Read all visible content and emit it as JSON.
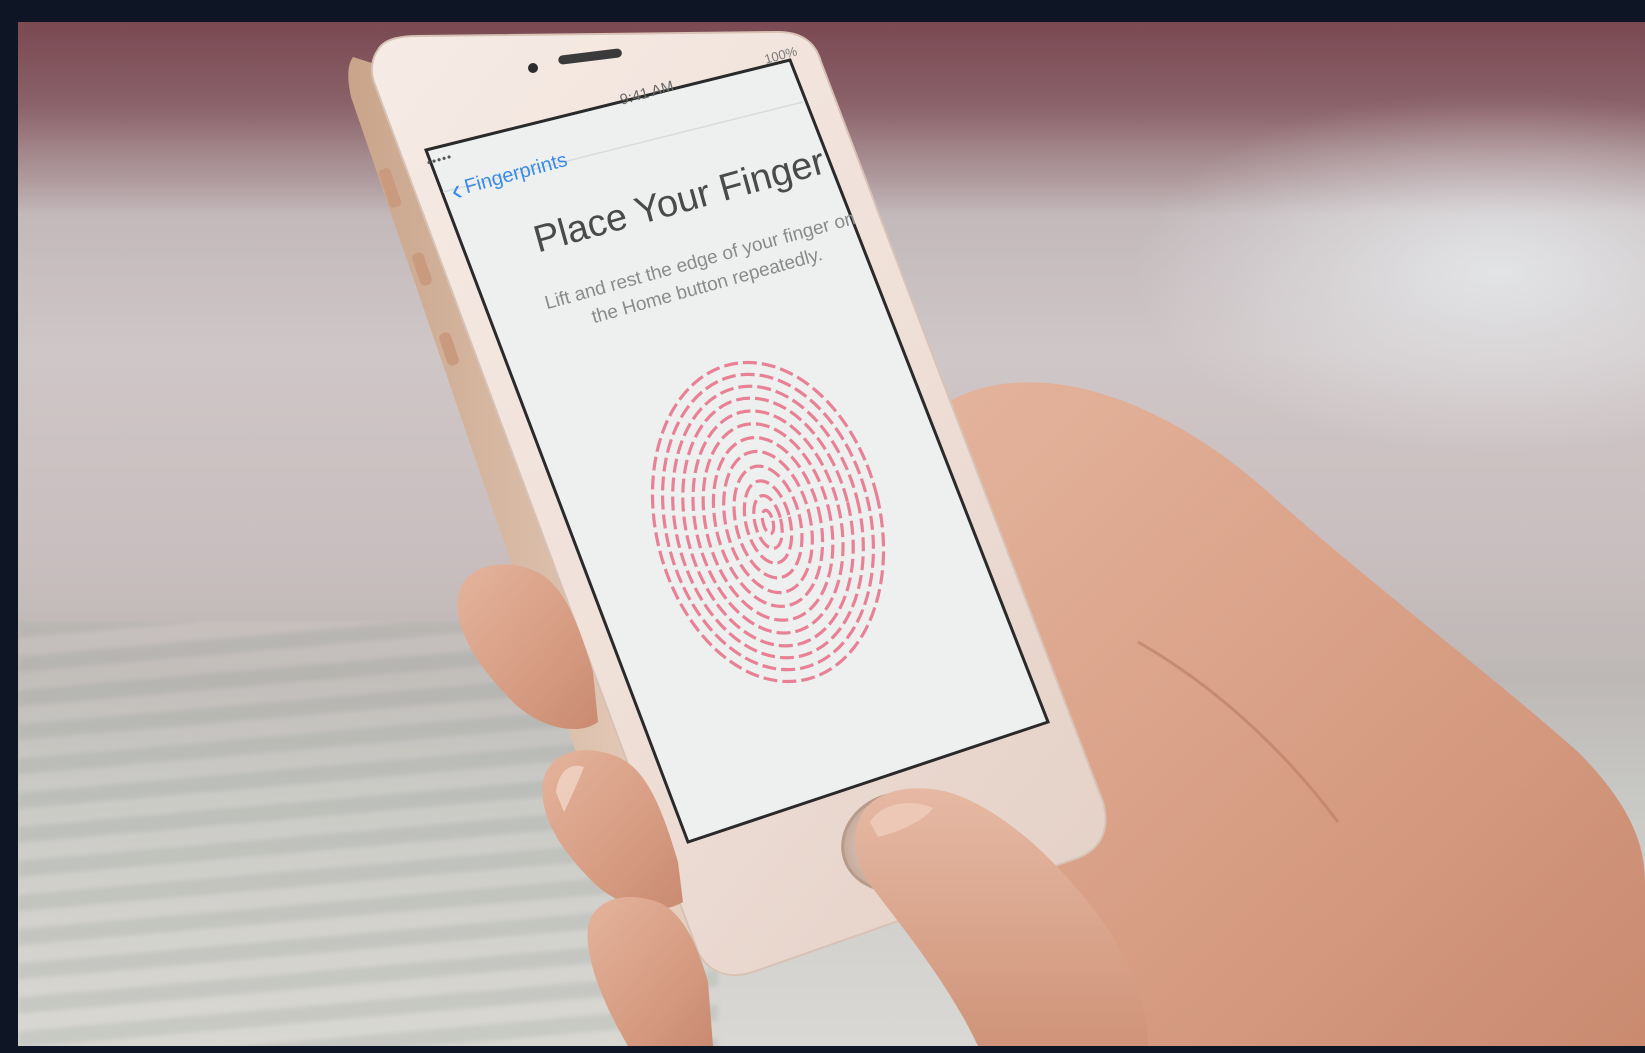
{
  "screen": {
    "status_time": "9:41 AM",
    "status_battery": "100%",
    "signal": "•••••",
    "back_label": "Fingerprints",
    "title": "Place Your Finger",
    "instructions": "Lift and rest the edge of your finger on the Home button repeatedly."
  },
  "colors": {
    "frame": "#0e1524",
    "accent_blue": "#3a8be6",
    "fingerprint": "#e8788e",
    "phone_body": "#f1e3dc",
    "screen_bg": "#eef0f0",
    "skin": "#d9a389"
  },
  "icons": {
    "back": "chevron-left-icon",
    "fingerprint": "fingerprint-icon"
  }
}
